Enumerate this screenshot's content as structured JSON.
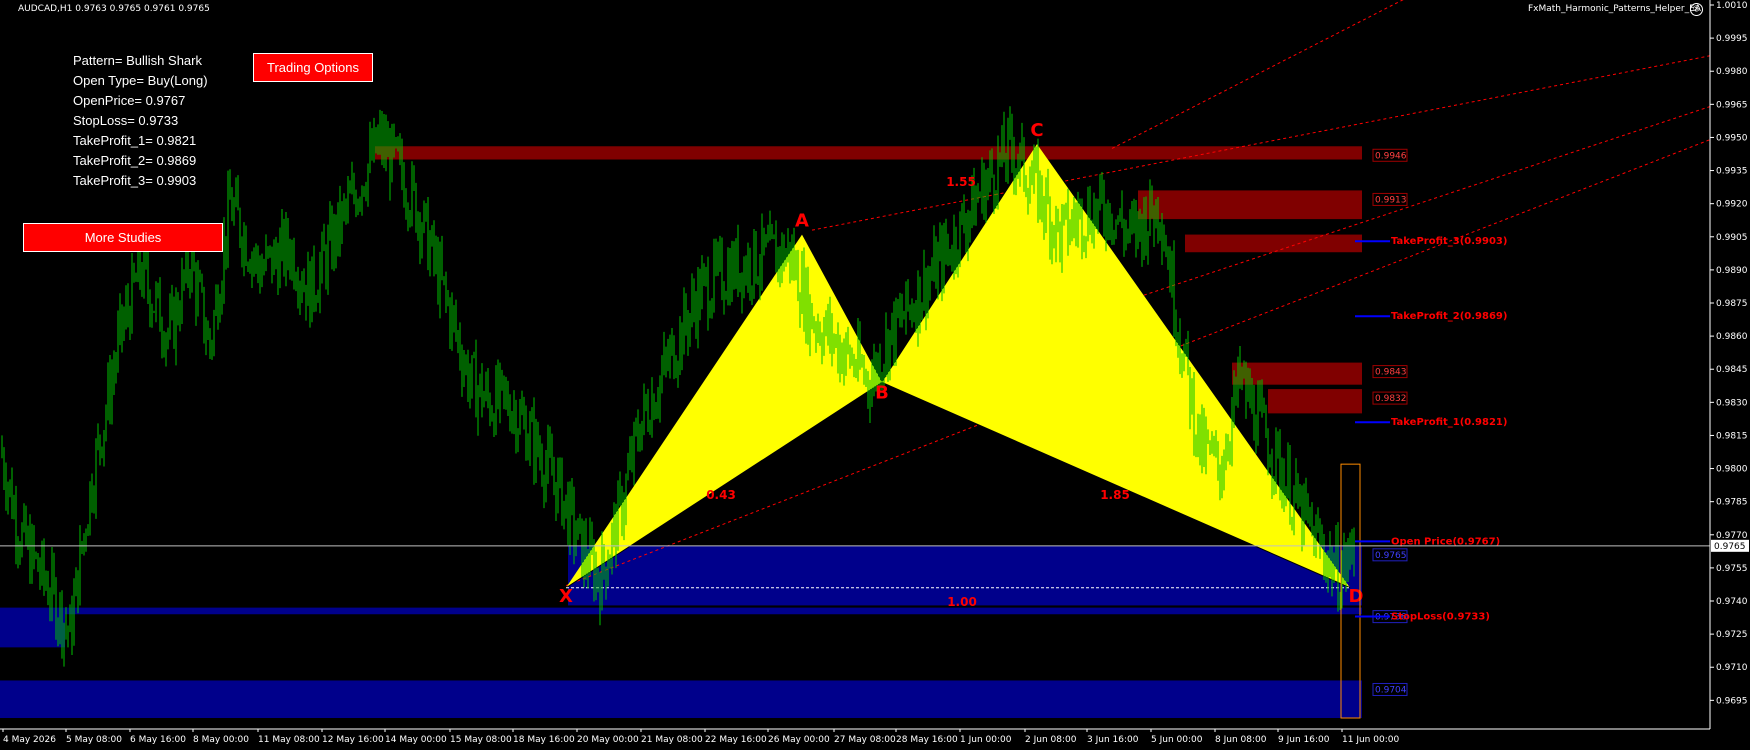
{
  "window": {
    "symbol_info": "AUDCAD,H1  0.9763 0.9765 0.9761 0.9765",
    "ea_name": "FxMath_Harmonic_Patterns_Helper_EA",
    "ea_icon": "smiley-icon"
  },
  "trade_info": {
    "pattern": "Pattern= Bullish Shark",
    "open_type": "Open Type= Buy(Long)",
    "open_price": "OpenPrice= 0.9767",
    "stop_loss": "StopLoss= 0.9733",
    "tp1": "TakeProfit_1= 0.9821",
    "tp2": "TakeProfit_2= 0.9869",
    "tp3": "TakeProfit_3= 0.9903"
  },
  "buttons": {
    "trading_options": "Trading Options",
    "more_studies": "More Studies"
  },
  "colors": {
    "background": "#000000",
    "candles": "#00c000",
    "pattern_fill": "#ffff00",
    "pattern_label": "#ff0000",
    "supply_zone": "#800000",
    "demand_zone": "#00008b",
    "level_line": "#0000ff",
    "channel_line": "#ff0000",
    "button": "#ff0000"
  },
  "chart_data": {
    "type": "candlestick",
    "symbol": "AUDCAD",
    "timeframe": "H1",
    "current_price": "0.9765",
    "ylim": [
      0.9687,
      1.001
    ],
    "price_ticks": [
      "1.0010",
      "0.9995",
      "0.9980",
      "0.9965",
      "0.9950",
      "0.9935",
      "0.9920",
      "0.9905",
      "0.9890",
      "0.9875",
      "0.9860",
      "0.9845",
      "0.9830",
      "0.9815",
      "0.9800",
      "0.9785",
      "0.9770",
      "0.9755",
      "0.9740",
      "0.9725",
      "0.9710",
      "0.9695"
    ],
    "time_labels": [
      "4 May 2026",
      "5 May 08:00",
      "6 May 16:00",
      "8 May 00:00",
      "11 May 08:00",
      "12 May 16:00",
      "14 May 00:00",
      "15 May 08:00",
      "18 May 16:00",
      "20 May 00:00",
      "21 May 08:00",
      "22 May 16:00",
      "26 May 00:00",
      "27 May 08:00",
      "28 May 16:00",
      "1 Jun 00:00",
      "2 Jun 08:00",
      "3 Jun 16:00",
      "5 Jun 00:00",
      "8 Jun 08:00",
      "9 Jun 16:00",
      "11 Jun 00:00"
    ],
    "price_path": [
      [
        0,
        0.981
      ],
      [
        0.02,
        0.977
      ],
      [
        0.05,
        0.9745
      ],
      [
        0.07,
        0.9725
      ],
      [
        0.09,
        0.979
      ],
      [
        0.12,
        0.986
      ],
      [
        0.14,
        0.989
      ],
      [
        0.17,
        0.986
      ],
      [
        0.19,
        0.9895
      ],
      [
        0.21,
        0.9855
      ],
      [
        0.23,
        0.992
      ],
      [
        0.26,
        0.989
      ],
      [
        0.29,
        0.99
      ],
      [
        0.31,
        0.988
      ],
      [
        0.33,
        0.99
      ],
      [
        0.36,
        0.993
      ],
      [
        0.38,
        0.9948
      ],
      [
        0.4,
        0.9935
      ],
      [
        0.42,
        0.9915
      ],
      [
        0.45,
        0.987
      ],
      [
        0.47,
        0.984
      ],
      [
        0.49,
        0.983
      ],
      [
        0.51,
        0.983
      ],
      [
        0.53,
        0.9815
      ],
      [
        0.56,
        0.979
      ],
      [
        0.58,
        0.9765
      ],
      [
        0.6,
        0.975
      ],
      [
        0.62,
        0.978
      ],
      [
        0.64,
        0.982
      ],
      [
        0.66,
        0.984
      ],
      [
        0.68,
        0.986
      ],
      [
        0.7,
        0.988
      ],
      [
        0.73,
        0.989
      ],
      [
        0.76,
        0.9895
      ],
      [
        0.79,
        0.9898
      ],
      [
        0.81,
        0.987
      ],
      [
        0.83,
        0.986
      ],
      [
        0.85,
        0.985
      ],
      [
        0.87,
        0.984
      ],
      [
        0.89,
        0.986
      ],
      [
        0.92,
        0.988
      ],
      [
        0.95,
        0.99
      ],
      [
        0.98,
        0.9925
      ],
      [
        1.01,
        0.9945
      ],
      [
        1.04,
        0.9925
      ],
      [
        1.06,
        0.9905
      ],
      [
        1.08,
        0.9915
      ],
      [
        1.11,
        0.9918
      ],
      [
        1.13,
        0.9905
      ],
      [
        1.16,
        0.992
      ],
      [
        1.18,
        0.986
      ],
      [
        1.2,
        0.981
      ],
      [
        1.22,
        0.98
      ],
      [
        1.24,
        0.984
      ],
      [
        1.26,
        0.982
      ],
      [
        1.28,
        0.98
      ],
      [
        1.3,
        0.978
      ],
      [
        1.32,
        0.9765
      ],
      [
        1.34,
        0.9752
      ],
      [
        1.355,
        0.9765
      ]
    ],
    "harmonic_pattern": {
      "name": "Bullish Shark",
      "points": [
        {
          "label": "X",
          "price": 0.9746
        },
        {
          "label": "A",
          "price": 0.9906
        },
        {
          "label": "B",
          "price": 0.9839
        },
        {
          "label": "C",
          "price": 0.9947
        },
        {
          "label": "D",
          "price": 0.9746
        }
      ],
      "ratios": [
        {
          "label": "0.43",
          "between": "XB"
        },
        {
          "label": "1.55",
          "between": "AC"
        },
        {
          "label": "1.85",
          "between": "BD"
        },
        {
          "label": "1.00",
          "between": "XD"
        }
      ]
    },
    "levels": [
      {
        "name": "TakeProfit_3",
        "price": 0.9903,
        "label": "TakeProfit_3(0.9903)"
      },
      {
        "name": "TakeProfit_2",
        "price": 0.9869,
        "label": "TakeProfit_2(0.9869)"
      },
      {
        "name": "TakeProfit_1",
        "price": 0.9821,
        "label": "TakeProfit_1(0.9821)"
      },
      {
        "name": "Open Price",
        "price": 0.9767,
        "label": "Open Price(0.9767)"
      },
      {
        "name": "StopLoss",
        "price": 0.9733,
        "label": "StopLoss(0.9733)"
      }
    ],
    "zone_labels": [
      {
        "text": "0.9946",
        "type": "supply"
      },
      {
        "text": "0.9913",
        "type": "supply"
      },
      {
        "text": "0.9843",
        "type": "supply"
      },
      {
        "text": "0.9832",
        "type": "supply"
      },
      {
        "text": "0.9765",
        "type": "demand"
      },
      {
        "text": "0.9736",
        "type": "demand"
      },
      {
        "text": "0.9704",
        "type": "demand"
      }
    ]
  }
}
